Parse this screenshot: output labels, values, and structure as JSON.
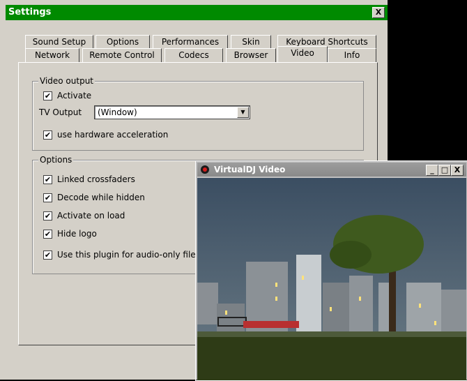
{
  "settings": {
    "title": "Settings",
    "close_label": "X",
    "tabs_row1": [
      "Sound Setup",
      "Options",
      "Performances",
      "Skin",
      "Keyboard Shortcuts"
    ],
    "tabs_row2": [
      "Network",
      "Remote Control",
      "Codecs",
      "Browser",
      "Video",
      "Info"
    ],
    "active_tab": "Video",
    "video_output": {
      "legend": "Video output",
      "activate": {
        "label": "Activate",
        "checked": true
      },
      "tv_output_label": "TV Output",
      "tv_output_value": "(Window)",
      "hw_accel": {
        "label": "use hardware acceleration",
        "checked": true
      }
    },
    "options": {
      "legend": "Options",
      "items": [
        {
          "label": "Linked crossfaders",
          "checked": true
        },
        {
          "label": "Decode while hidden",
          "checked": true
        },
        {
          "label": "Activate on load",
          "checked": true
        },
        {
          "label": "Hide logo",
          "checked": true
        },
        {
          "label": "Use this plugin for audio-only files",
          "checked": true
        }
      ]
    }
  },
  "video_window": {
    "title": "VirtualDJ Video",
    "min_label": "_",
    "max_label": "□",
    "close_label": "X"
  },
  "colors": {
    "settings_titlebar": "#008a00",
    "dialog_face": "#d4d0c8",
    "video_titlebar": "#8f8f8f"
  }
}
